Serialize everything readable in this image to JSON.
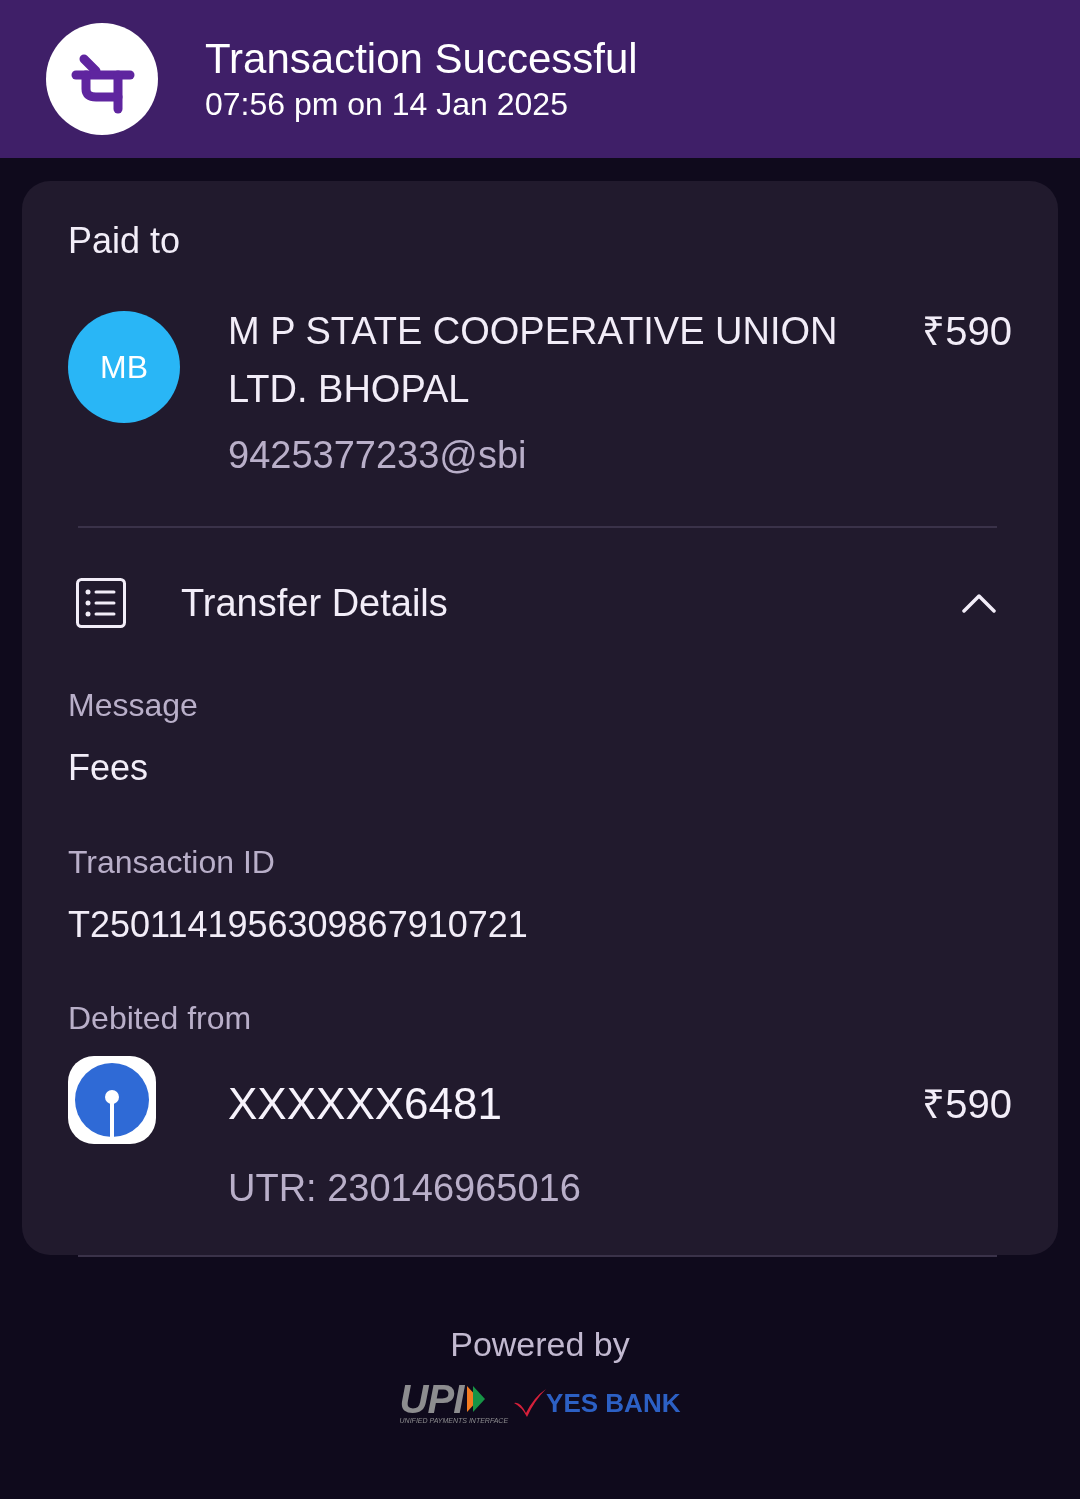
{
  "header": {
    "title": "Transaction Successful",
    "subtitle": "07:56 pm on 14 Jan 2025"
  },
  "paid_to": {
    "label": "Paid to",
    "avatar_initials": "MB",
    "name": "M P STATE COOPERATIVE UNION LTD. BHOPAL",
    "amount": "₹590",
    "upi_id": "9425377233@sbi"
  },
  "transfer_details": {
    "title": "Transfer Details",
    "expanded": true,
    "fields": [
      {
        "label": "Message",
        "value": "Fees"
      },
      {
        "label": "Transaction ID",
        "value": "T2501141956309867910721"
      }
    ],
    "debited_from": {
      "label": "Debited from",
      "account": "XXXXXX6481",
      "amount": "₹590",
      "utr": "UTR: 230146965016"
    }
  },
  "footer": {
    "powered_by": "Powered by",
    "logos": [
      {
        "kind": "upi",
        "text": "UPI",
        "tagline": "UNIFIED PAYMENTS INTERFACE"
      },
      {
        "kind": "bank",
        "text": "YES BANK"
      }
    ]
  }
}
